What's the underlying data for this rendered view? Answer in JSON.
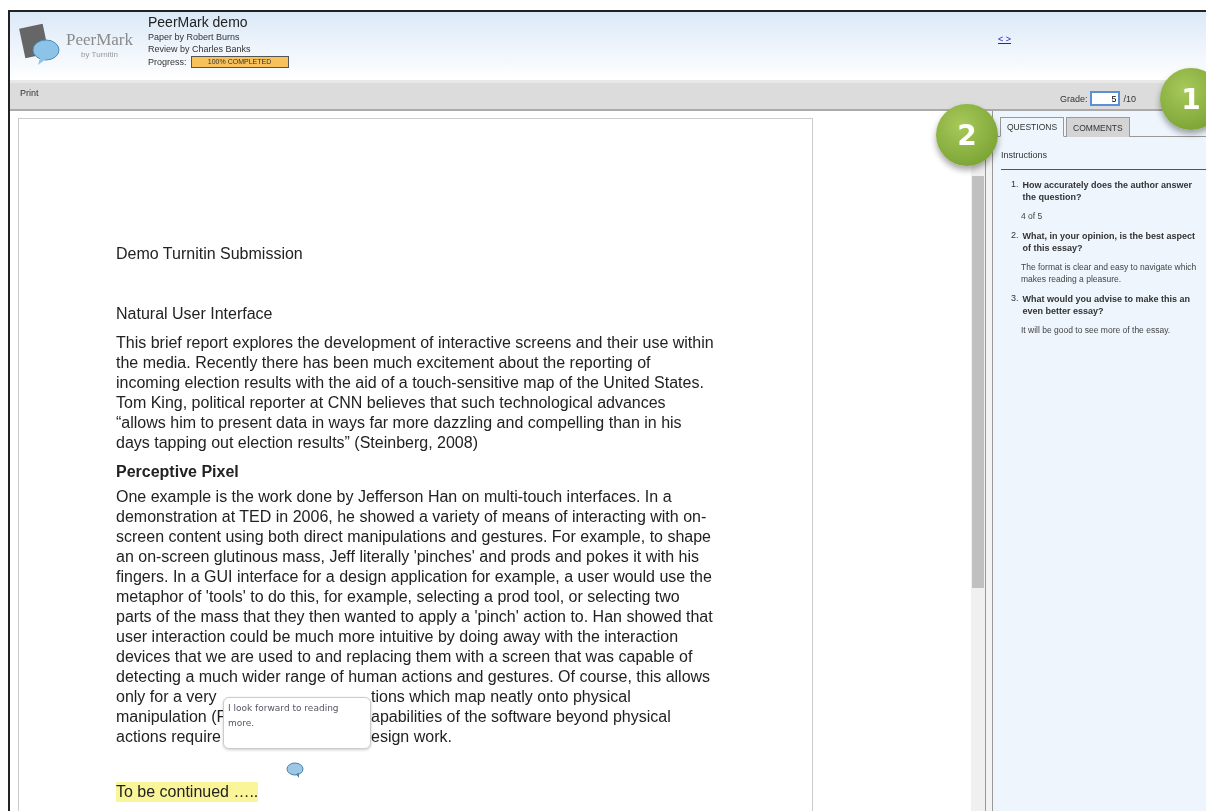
{
  "header": {
    "logo_text": "PeerMark",
    "logo_sub": "by Turnitin",
    "title": "PeerMark demo",
    "paper_by": "Paper by Robert Burns",
    "review_by": "Review by Charles Banks",
    "progress_label": "Progress:",
    "progress": {
      "text": "100% COMPLETED",
      "level": 1
    },
    "nav_link": "< >"
  },
  "toolbar": {
    "print": "Print",
    "grade_label": "Grade:",
    "grade_value": "5",
    "grade_max": "/10"
  },
  "document": {
    "title": "Demo Turnitin Submission",
    "heading": "Natural User Interface",
    "paragraph_1": [
      "This brief report explores the development of interactive screens and their use within",
      "the media.  Recently there has been much excitement about the reporting of",
      "incoming election results with the aid of a touch-sensitive map of the United States.",
      "Tom King, political reporter at CNN believes that such technological advances",
      "“allows him to present data in ways far more dazzling and compelling than in his",
      "days tapping out election results” (Steinberg, 2008)"
    ],
    "subheading": "Perceptive Pixel",
    "paragraph_2": [
      "One example is the work done by Jefferson Han on multi-touch interfaces. In a",
      "demonstration at TED in 2006, he showed a variety of means of interacting with on-",
      "screen content using both direct manipulations and gestures. For example, to shape",
      "an on-screen glutinous mass, Jeff literally 'pinches' and prods and pokes it with his",
      "fingers. In a GUI interface for a design application for example, a user would use the",
      "metaphor of 'tools' to do this, for example, selecting a prod tool, or selecting two",
      "parts of the mass that they then wanted to apply a 'pinch' action to. Han showed that",
      "user interaction could be much more intuitive by doing away with the interaction",
      "devices that we are used to and replacing them with a screen that was capable of",
      "detecting a much wider range of human actions and gestures. Of course, this allows"
    ],
    "covered_lines": [
      {
        "left": "only for a very",
        "right": "tions which map neatly onto physical"
      },
      {
        "left": "manipulation (F",
        "right": "apabilities of the software beyond physical"
      },
      {
        "left": "actions require",
        "right": "esign work."
      }
    ],
    "comment_bubble": "I look forward to reading more.",
    "highlighted": "To be continued ….."
  },
  "panel": {
    "tabs": [
      {
        "label": "QUESTIONS",
        "selected": true
      },
      {
        "label": "COMMENTS",
        "selected": false
      }
    ],
    "instructions": "Instructions",
    "questions": [
      {
        "number": "1.",
        "question": "How accurately does the author answer the question?",
        "answer": "4 of 5"
      },
      {
        "number": "2.",
        "question": "What, in your opinion, is the best aspect of this essay?",
        "answer": "The format is clear and easy to navigate which makes reading a pleasure."
      },
      {
        "number": "3.",
        "question": "What would you advise to make this an even better essay?",
        "answer": "It will be good to see more of the essay."
      }
    ]
  },
  "callouts": [
    "1",
    "2"
  ]
}
